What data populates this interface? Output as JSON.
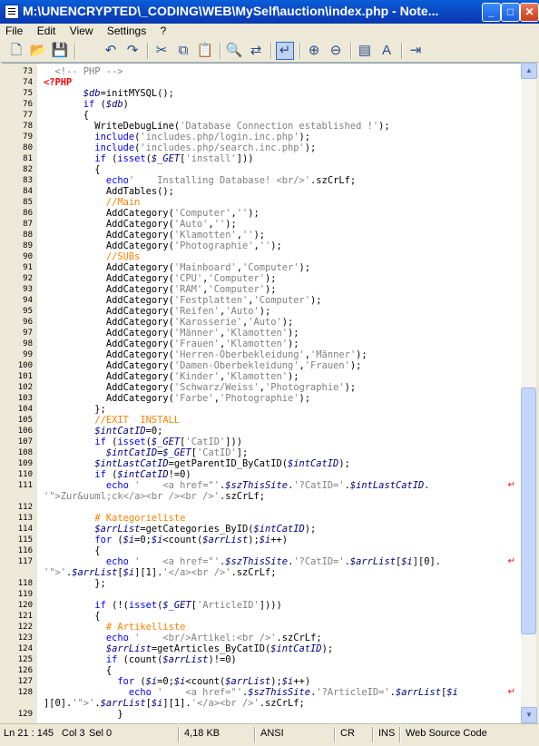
{
  "window": {
    "title": "M:\\UNENCRYPTED\\_CODING\\WEB\\MySelf\\auction\\index.php - Note..."
  },
  "menu": [
    "File",
    "Edit",
    "View",
    "Settings",
    "?"
  ],
  "toolbar": [
    "new-icon",
    "open-icon",
    "save-icon",
    "undo-icon",
    "redo-icon",
    "cut-icon",
    "copy-icon",
    "paste-icon",
    "find-icon",
    "replace-icon",
    "word-wrap-icon",
    "zoom-in-icon",
    "zoom-out-icon",
    "scheme-icon",
    "font-icon",
    "exit-icon"
  ],
  "lines": [
    {
      "n": "73"
    },
    {
      "n": "74"
    },
    {
      "n": "75"
    },
    {
      "n": "76"
    },
    {
      "n": "77"
    },
    {
      "n": "78"
    },
    {
      "n": "79"
    },
    {
      "n": "80"
    },
    {
      "n": "81"
    },
    {
      "n": "82"
    },
    {
      "n": "83"
    },
    {
      "n": "84"
    },
    {
      "n": "85"
    },
    {
      "n": "86"
    },
    {
      "n": "87"
    },
    {
      "n": "88"
    },
    {
      "n": "89"
    },
    {
      "n": "90"
    },
    {
      "n": "91"
    },
    {
      "n": "92"
    },
    {
      "n": "93"
    },
    {
      "n": "94"
    },
    {
      "n": "95"
    },
    {
      "n": "96"
    },
    {
      "n": "97"
    },
    {
      "n": "98"
    },
    {
      "n": "99"
    },
    {
      "n": "100"
    },
    {
      "n": "101"
    },
    {
      "n": "102"
    },
    {
      "n": "103"
    },
    {
      "n": "104"
    },
    {
      "n": "105"
    },
    {
      "n": "106"
    },
    {
      "n": "107"
    },
    {
      "n": "108"
    },
    {
      "n": "109"
    },
    {
      "n": "110"
    },
    {
      "n": "111"
    },
    {
      "n": ""
    },
    {
      "n": "112"
    },
    {
      "n": "113"
    },
    {
      "n": "114"
    },
    {
      "n": "115"
    },
    {
      "n": "116"
    },
    {
      "n": "117"
    },
    {
      "n": ""
    },
    {
      "n": "118"
    },
    {
      "n": "119"
    },
    {
      "n": "120"
    },
    {
      "n": "121"
    },
    {
      "n": "122"
    },
    {
      "n": "123"
    },
    {
      "n": "124"
    },
    {
      "n": "125"
    },
    {
      "n": "126"
    },
    {
      "n": "127"
    },
    {
      "n": "128"
    },
    {
      "n": ""
    },
    {
      "n": "129"
    }
  ],
  "code": [
    [
      [
        "s",
        "  <!-- PHP -->"
      ]
    ],
    [
      [
        "t",
        "<?PHP"
      ]
    ],
    [
      [
        "",
        "       "
      ],
      [
        "v",
        "$db"
      ],
      [
        "",
        "=initMYSQL();"
      ]
    ],
    [
      [
        "",
        "       "
      ],
      [
        "k",
        "if"
      ],
      [
        "",
        " ("
      ],
      [
        "v",
        "$db"
      ],
      [
        "",
        ")"
      ]
    ],
    [
      [
        "",
        "       {"
      ]
    ],
    [
      [
        "",
        "         WriteDebugLine("
      ],
      [
        "s",
        "'Database Connection established !'"
      ],
      [
        "",
        ");"
      ]
    ],
    [
      [
        "",
        "         "
      ],
      [
        "k",
        "include"
      ],
      [
        "",
        "("
      ],
      [
        "s",
        "'includes.php/login.inc.php'"
      ],
      [
        "",
        ");"
      ]
    ],
    [
      [
        "",
        "         "
      ],
      [
        "k",
        "include"
      ],
      [
        "",
        "("
      ],
      [
        "s",
        "'includes.php/search.inc.php'"
      ],
      [
        "",
        ");"
      ]
    ],
    [
      [
        "",
        "         "
      ],
      [
        "k",
        "if"
      ],
      [
        "",
        " ("
      ],
      [
        "k",
        "isset"
      ],
      [
        "",
        "("
      ],
      [
        "v",
        "$_GET"
      ],
      [
        "",
        "["
      ],
      [
        "s",
        "'install'"
      ],
      [
        "",
        "]))"
      ]
    ],
    [
      [
        "",
        "         {"
      ]
    ],
    [
      [
        "",
        "           "
      ],
      [
        "k",
        "echo"
      ],
      [
        "",
        ""
      ],
      [
        "s",
        "'    Installing Database! <br/>'"
      ],
      [
        "",
        ".szCrLf;"
      ]
    ],
    [
      [
        "",
        "           AddTables();"
      ]
    ],
    [
      [
        "",
        "           "
      ],
      [
        "c",
        "//Main"
      ]
    ],
    [
      [
        "",
        "           AddCategory("
      ],
      [
        "s",
        "'Computer'"
      ],
      [
        "",
        ","
      ],
      [
        "s",
        "''"
      ],
      [
        "",
        ");"
      ]
    ],
    [
      [
        "",
        "           AddCategory("
      ],
      [
        "s",
        "'Auto'"
      ],
      [
        "",
        ","
      ],
      [
        "s",
        "''"
      ],
      [
        "",
        ");"
      ]
    ],
    [
      [
        "",
        "           AddCategory("
      ],
      [
        "s",
        "'Klamotten'"
      ],
      [
        "",
        ","
      ],
      [
        "s",
        "''"
      ],
      [
        "",
        ");"
      ]
    ],
    [
      [
        "",
        "           AddCategory("
      ],
      [
        "s",
        "'Photographie'"
      ],
      [
        "",
        ","
      ],
      [
        "s",
        "''"
      ],
      [
        "",
        ");"
      ]
    ],
    [
      [
        "",
        "           "
      ],
      [
        "c",
        "//SUBs"
      ]
    ],
    [
      [
        "",
        "           AddCategory("
      ],
      [
        "s",
        "'Mainboard'"
      ],
      [
        "",
        ","
      ],
      [
        "s",
        "'Computer'"
      ],
      [
        "",
        ");"
      ]
    ],
    [
      [
        "",
        "           AddCategory("
      ],
      [
        "s",
        "'CPU'"
      ],
      [
        "",
        ","
      ],
      [
        "s",
        "'Computer'"
      ],
      [
        "",
        ");"
      ]
    ],
    [
      [
        "",
        "           AddCategory("
      ],
      [
        "s",
        "'RAM'"
      ],
      [
        "",
        ","
      ],
      [
        "s",
        "'Computer'"
      ],
      [
        "",
        ");"
      ]
    ],
    [
      [
        "",
        "           AddCategory("
      ],
      [
        "s",
        "'Festplatten'"
      ],
      [
        "",
        ","
      ],
      [
        "s",
        "'Computer'"
      ],
      [
        "",
        ");"
      ]
    ],
    [
      [
        "",
        "           AddCategory("
      ],
      [
        "s",
        "'Reifen'"
      ],
      [
        "",
        ","
      ],
      [
        "s",
        "'Auto'"
      ],
      [
        "",
        ");"
      ]
    ],
    [
      [
        "",
        "           AddCategory("
      ],
      [
        "s",
        "'Karosserie'"
      ],
      [
        "",
        ","
      ],
      [
        "s",
        "'Auto'"
      ],
      [
        "",
        ");"
      ]
    ],
    [
      [
        "",
        "           AddCategory("
      ],
      [
        "s",
        "'Männer'"
      ],
      [
        "",
        ","
      ],
      [
        "s",
        "'Klamotten'"
      ],
      [
        "",
        ");"
      ]
    ],
    [
      [
        "",
        "           AddCategory("
      ],
      [
        "s",
        "'Frauen'"
      ],
      [
        "",
        ","
      ],
      [
        "s",
        "'Klamotten'"
      ],
      [
        "",
        ");"
      ]
    ],
    [
      [
        "",
        "           AddCategory("
      ],
      [
        "s",
        "'Herren-Oberbekleidung'"
      ],
      [
        "",
        ","
      ],
      [
        "s",
        "'Männer'"
      ],
      [
        "",
        ");"
      ]
    ],
    [
      [
        "",
        "           AddCategory("
      ],
      [
        "s",
        "'Damen-Oberbekleidung'"
      ],
      [
        "",
        ","
      ],
      [
        "s",
        "'Frauen'"
      ],
      [
        "",
        ");"
      ]
    ],
    [
      [
        "",
        "           AddCategory("
      ],
      [
        "s",
        "'Kinder'"
      ],
      [
        "",
        ","
      ],
      [
        "s",
        "'Klamotten'"
      ],
      [
        "",
        ");"
      ]
    ],
    [
      [
        "",
        "           AddCategory("
      ],
      [
        "s",
        "'Schwarz/Weiss'"
      ],
      [
        "",
        ","
      ],
      [
        "s",
        "'Photographie'"
      ],
      [
        "",
        ");"
      ]
    ],
    [
      [
        "",
        "           AddCategory("
      ],
      [
        "s",
        "'Farbe'"
      ],
      [
        "",
        ","
      ],
      [
        "s",
        "'Photographie'"
      ],
      [
        "",
        ");"
      ]
    ],
    [
      [
        "",
        "         };"
      ]
    ],
    [
      [
        "",
        "         "
      ],
      [
        "c",
        "//EXIT  INSTALL"
      ]
    ],
    [
      [
        "",
        "         "
      ],
      [
        "v",
        "$intCatID"
      ],
      [
        "",
        "=0;"
      ]
    ],
    [
      [
        "",
        "         "
      ],
      [
        "k",
        "if"
      ],
      [
        "",
        " ("
      ],
      [
        "k",
        "isset"
      ],
      [
        "",
        "("
      ],
      [
        "v",
        "$_GET"
      ],
      [
        "",
        "["
      ],
      [
        "s",
        "'CatID'"
      ],
      [
        "",
        "]))"
      ]
    ],
    [
      [
        "",
        "           "
      ],
      [
        "v",
        "$intCatID"
      ],
      [
        "",
        "="
      ],
      [
        "v",
        "$_GET"
      ],
      [
        "",
        "["
      ],
      [
        "s",
        "'CatID'"
      ],
      [
        "",
        "];"
      ]
    ],
    [
      [
        "",
        "         "
      ],
      [
        "v",
        "$intLastCatID"
      ],
      [
        "",
        "=getParentID_ByCatID("
      ],
      [
        "v",
        "$intCatID"
      ],
      [
        "",
        ");"
      ]
    ],
    [
      [
        "",
        "         "
      ],
      [
        "k",
        "if"
      ],
      [
        "",
        " ("
      ],
      [
        "v",
        "$intCatID"
      ],
      [
        "",
        "!=0)"
      ]
    ],
    [
      [
        "",
        "           "
      ],
      [
        "k",
        "echo"
      ],
      [
        "",
        " "
      ],
      [
        "s",
        "'    <a href=\"'"
      ],
      [
        "",
        "."
      ],
      [
        "v",
        "$szThisSite"
      ],
      [
        "",
        "."
      ],
      [
        "s",
        "'?CatID='"
      ],
      [
        "",
        "."
      ],
      [
        "v",
        "$intLastCatID"
      ],
      [
        "",
        "."
      ]
    ],
    [
      [
        "s",
        "'\">Zur&uuml;ck</a><br /><br />'"
      ],
      [
        "",
        ".szCrLf;"
      ]
    ],
    [
      [
        "",
        ""
      ]
    ],
    [
      [
        "",
        "         "
      ],
      [
        "c",
        "# Kategorieliste"
      ]
    ],
    [
      [
        "",
        "         "
      ],
      [
        "v",
        "$arrList"
      ],
      [
        "",
        "=getCategories_ByID("
      ],
      [
        "v",
        "$intCatID"
      ],
      [
        "",
        ");"
      ]
    ],
    [
      [
        "",
        "         "
      ],
      [
        "k",
        "for"
      ],
      [
        "",
        " ("
      ],
      [
        "v",
        "$i"
      ],
      [
        "",
        "=0;"
      ],
      [
        "v",
        "$i"
      ],
      [
        "",
        "<count("
      ],
      [
        "v",
        "$arrList"
      ],
      [
        "",
        ");"
      ],
      [
        "v",
        "$i"
      ],
      [
        "",
        "++)"
      ]
    ],
    [
      [
        "",
        "         {"
      ]
    ],
    [
      [
        "",
        "           "
      ],
      [
        "k",
        "echo"
      ],
      [
        "",
        " "
      ],
      [
        "s",
        "'    <a href=\"'"
      ],
      [
        "",
        "."
      ],
      [
        "v",
        "$szThisSite"
      ],
      [
        "",
        "."
      ],
      [
        "s",
        "'?CatID='"
      ],
      [
        "",
        "."
      ],
      [
        "v",
        "$arrList"
      ],
      [
        "",
        "["
      ],
      [
        "v",
        "$i"
      ],
      [
        "",
        "][0]."
      ]
    ],
    [
      [
        "s",
        "'\">'"
      ],
      [
        "",
        "."
      ],
      [
        "v",
        "$arrList"
      ],
      [
        "",
        "["
      ],
      [
        "v",
        "$i"
      ],
      [
        "",
        "][1]."
      ],
      [
        "s",
        "'</a><br />'"
      ],
      [
        "",
        ".szCrLf;"
      ]
    ],
    [
      [
        "",
        "         };"
      ]
    ],
    [
      [
        "",
        ""
      ]
    ],
    [
      [
        "",
        "         "
      ],
      [
        "k",
        "if"
      ],
      [
        "",
        " (!("
      ],
      [
        "k",
        "isset"
      ],
      [
        "",
        "("
      ],
      [
        "v",
        "$_GET"
      ],
      [
        "",
        "["
      ],
      [
        "s",
        "'ArticleID'"
      ],
      [
        "",
        "])))"
      ]
    ],
    [
      [
        "",
        "         {"
      ]
    ],
    [
      [
        "",
        "           "
      ],
      [
        "c",
        "# Artikelliste"
      ]
    ],
    [
      [
        "",
        "           "
      ],
      [
        "k",
        "echo"
      ],
      [
        "",
        " "
      ],
      [
        "s",
        "'    <br/>Artikel:<br />'"
      ],
      [
        "",
        ".szCrLf;"
      ]
    ],
    [
      [
        "",
        "           "
      ],
      [
        "v",
        "$arrList"
      ],
      [
        "",
        "=getArticles_ByCatID("
      ],
      [
        "v",
        "$intCatID"
      ],
      [
        "",
        ");"
      ]
    ],
    [
      [
        "",
        "           "
      ],
      [
        "k",
        "if"
      ],
      [
        "",
        " (count("
      ],
      [
        "v",
        "$arrList"
      ],
      [
        "",
        ")!=0)"
      ]
    ],
    [
      [
        "",
        "           {"
      ]
    ],
    [
      [
        "",
        "             "
      ],
      [
        "k",
        "for"
      ],
      [
        "",
        " ("
      ],
      [
        "v",
        "$i"
      ],
      [
        "",
        "=0;"
      ],
      [
        "v",
        "$i"
      ],
      [
        "",
        "<count("
      ],
      [
        "v",
        "$arrList"
      ],
      [
        "",
        ");"
      ],
      [
        "v",
        "$i"
      ],
      [
        "",
        "++)"
      ]
    ],
    [
      [
        "",
        "               "
      ],
      [
        "k",
        "echo"
      ],
      [
        "",
        " "
      ],
      [
        "s",
        "'    <a href=\"'"
      ],
      [
        "",
        "."
      ],
      [
        "v",
        "$szThisSite"
      ],
      [
        "",
        "."
      ],
      [
        "s",
        "'?ArticleID='"
      ],
      [
        "",
        "."
      ],
      [
        "v",
        "$arrList"
      ],
      [
        "",
        "["
      ],
      [
        "v",
        "$i"
      ]
    ],
    [
      [
        "",
        "][0]."
      ],
      [
        "s",
        "'\">'"
      ],
      [
        "",
        "."
      ],
      [
        "v",
        "$arrList"
      ],
      [
        "",
        "["
      ],
      [
        "v",
        "$i"
      ],
      [
        "",
        "][1]."
      ],
      [
        "s",
        "'</a><br />'"
      ],
      [
        "",
        ".szCrLf;"
      ]
    ],
    [
      [
        "",
        "             }"
      ]
    ]
  ],
  "wrapmarks": [
    38,
    45,
    57
  ],
  "status": {
    "position": "Ln 21 : 145",
    "col": "Col 3",
    "sel": "Sel 0",
    "size": "4,18 KB",
    "encoding": "ANSI",
    "eol": "CR",
    "ins": "INS",
    "scheme": "Web Source Code"
  }
}
